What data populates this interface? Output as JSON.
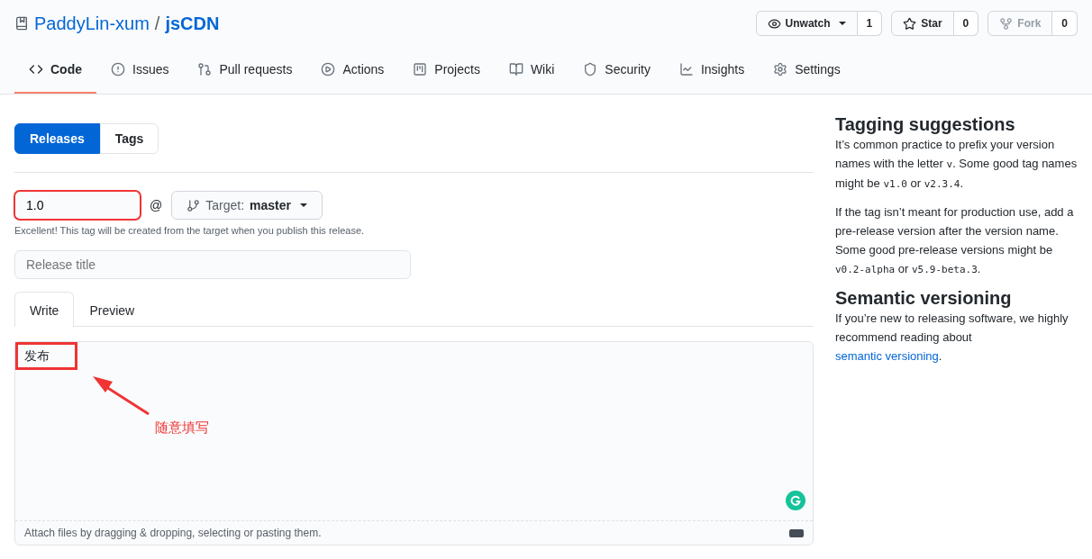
{
  "repo": {
    "owner": "PaddyLin-xum",
    "separator": "/",
    "name": "jsCDN"
  },
  "repo_actions": [
    {
      "kind": "watch",
      "label": "Unwatch",
      "count": "1",
      "disabled": false
    },
    {
      "kind": "star",
      "label": "Star",
      "count": "0",
      "disabled": false
    },
    {
      "kind": "fork",
      "label": "Fork",
      "count": "0",
      "disabled": true
    }
  ],
  "nav_tabs": [
    {
      "kind": "code",
      "label": "Code",
      "selected": true
    },
    {
      "kind": "issues",
      "label": "Issues",
      "selected": false
    },
    {
      "kind": "pulls",
      "label": "Pull requests",
      "selected": false
    },
    {
      "kind": "actions",
      "label": "Actions",
      "selected": false
    },
    {
      "kind": "projects",
      "label": "Projects",
      "selected": false
    },
    {
      "kind": "wiki",
      "label": "Wiki",
      "selected": false
    },
    {
      "kind": "security",
      "label": "Security",
      "selected": false
    },
    {
      "kind": "insights",
      "label": "Insights",
      "selected": false
    },
    {
      "kind": "settings",
      "label": "Settings",
      "selected": false
    }
  ],
  "subnav": [
    {
      "label": "Releases",
      "selected": true
    },
    {
      "label": "Tags",
      "selected": false
    }
  ],
  "tag_field": {
    "value": "1.0",
    "highlighted": true
  },
  "at_sign": "@",
  "target": {
    "label": "Target:",
    "branch": "master"
  },
  "tag_note": "Excellent! This tag will be created from the target when you publish this release.",
  "title_field": {
    "placeholder": "Release title"
  },
  "editor_tabs": [
    {
      "label": "Write",
      "selected": true
    },
    {
      "label": "Preview",
      "selected": false
    }
  ],
  "body_field": {
    "value": "发布",
    "highlighted": true
  },
  "annotation": {
    "label": "随意填写"
  },
  "attach_hint": "Attach files by dragging & dropping, selecting or pasting them.",
  "sidebar": [
    {
      "heading": "Tagging suggestions",
      "paragraphs": [
        [
          {
            "kind": "text",
            "text": "It’s common practice to prefix your version names with the letter "
          },
          {
            "kind": "code",
            "text": "v"
          },
          {
            "kind": "text",
            "text": ". Some good tag names might be "
          },
          {
            "kind": "code",
            "text": "v1.0"
          },
          {
            "kind": "text",
            "text": " or "
          },
          {
            "kind": "code",
            "text": "v2.3.4"
          },
          {
            "kind": "text",
            "text": "."
          }
        ],
        [
          {
            "kind": "text",
            "text": "If the tag isn’t meant for production use, add a pre-release version after the version name. Some good pre-release versions might be "
          },
          {
            "kind": "code",
            "text": "v0.2-alpha"
          },
          {
            "kind": "text",
            "text": " or "
          },
          {
            "kind": "code",
            "text": "v5.9-beta.3"
          },
          {
            "kind": "text",
            "text": "."
          }
        ]
      ]
    },
    {
      "heading": "Semantic versioning",
      "paragraphs": [
        [
          {
            "kind": "text",
            "text": "If you’re new to releasing software, we highly recommend reading about "
          },
          {
            "kind": "link",
            "text": "semantic versioning"
          },
          {
            "kind": "text",
            "text": "."
          }
        ]
      ]
    }
  ]
}
